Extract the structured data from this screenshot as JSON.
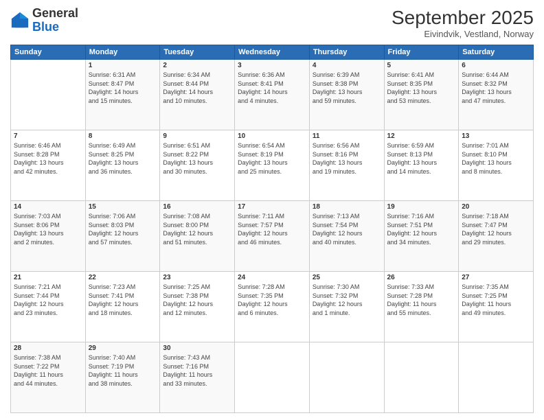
{
  "header": {
    "logo_general": "General",
    "logo_blue": "Blue",
    "month_title": "September 2025",
    "location": "Eivindvik, Vestland, Norway"
  },
  "days_of_week": [
    "Sunday",
    "Monday",
    "Tuesday",
    "Wednesday",
    "Thursday",
    "Friday",
    "Saturday"
  ],
  "weeks": [
    [
      {
        "day": "",
        "info": ""
      },
      {
        "day": "1",
        "info": "Sunrise: 6:31 AM\nSunset: 8:47 PM\nDaylight: 14 hours\nand 15 minutes."
      },
      {
        "day": "2",
        "info": "Sunrise: 6:34 AM\nSunset: 8:44 PM\nDaylight: 14 hours\nand 10 minutes."
      },
      {
        "day": "3",
        "info": "Sunrise: 6:36 AM\nSunset: 8:41 PM\nDaylight: 14 hours\nand 4 minutes."
      },
      {
        "day": "4",
        "info": "Sunrise: 6:39 AM\nSunset: 8:38 PM\nDaylight: 13 hours\nand 59 minutes."
      },
      {
        "day": "5",
        "info": "Sunrise: 6:41 AM\nSunset: 8:35 PM\nDaylight: 13 hours\nand 53 minutes."
      },
      {
        "day": "6",
        "info": "Sunrise: 6:44 AM\nSunset: 8:32 PM\nDaylight: 13 hours\nand 47 minutes."
      }
    ],
    [
      {
        "day": "7",
        "info": "Sunrise: 6:46 AM\nSunset: 8:28 PM\nDaylight: 13 hours\nand 42 minutes."
      },
      {
        "day": "8",
        "info": "Sunrise: 6:49 AM\nSunset: 8:25 PM\nDaylight: 13 hours\nand 36 minutes."
      },
      {
        "day": "9",
        "info": "Sunrise: 6:51 AM\nSunset: 8:22 PM\nDaylight: 13 hours\nand 30 minutes."
      },
      {
        "day": "10",
        "info": "Sunrise: 6:54 AM\nSunset: 8:19 PM\nDaylight: 13 hours\nand 25 minutes."
      },
      {
        "day": "11",
        "info": "Sunrise: 6:56 AM\nSunset: 8:16 PM\nDaylight: 13 hours\nand 19 minutes."
      },
      {
        "day": "12",
        "info": "Sunrise: 6:59 AM\nSunset: 8:13 PM\nDaylight: 13 hours\nand 14 minutes."
      },
      {
        "day": "13",
        "info": "Sunrise: 7:01 AM\nSunset: 8:10 PM\nDaylight: 13 hours\nand 8 minutes."
      }
    ],
    [
      {
        "day": "14",
        "info": "Sunrise: 7:03 AM\nSunset: 8:06 PM\nDaylight: 13 hours\nand 2 minutes."
      },
      {
        "day": "15",
        "info": "Sunrise: 7:06 AM\nSunset: 8:03 PM\nDaylight: 12 hours\nand 57 minutes."
      },
      {
        "day": "16",
        "info": "Sunrise: 7:08 AM\nSunset: 8:00 PM\nDaylight: 12 hours\nand 51 minutes."
      },
      {
        "day": "17",
        "info": "Sunrise: 7:11 AM\nSunset: 7:57 PM\nDaylight: 12 hours\nand 46 minutes."
      },
      {
        "day": "18",
        "info": "Sunrise: 7:13 AM\nSunset: 7:54 PM\nDaylight: 12 hours\nand 40 minutes."
      },
      {
        "day": "19",
        "info": "Sunrise: 7:16 AM\nSunset: 7:51 PM\nDaylight: 12 hours\nand 34 minutes."
      },
      {
        "day": "20",
        "info": "Sunrise: 7:18 AM\nSunset: 7:47 PM\nDaylight: 12 hours\nand 29 minutes."
      }
    ],
    [
      {
        "day": "21",
        "info": "Sunrise: 7:21 AM\nSunset: 7:44 PM\nDaylight: 12 hours\nand 23 minutes."
      },
      {
        "day": "22",
        "info": "Sunrise: 7:23 AM\nSunset: 7:41 PM\nDaylight: 12 hours\nand 18 minutes."
      },
      {
        "day": "23",
        "info": "Sunrise: 7:25 AM\nSunset: 7:38 PM\nDaylight: 12 hours\nand 12 minutes."
      },
      {
        "day": "24",
        "info": "Sunrise: 7:28 AM\nSunset: 7:35 PM\nDaylight: 12 hours\nand 6 minutes."
      },
      {
        "day": "25",
        "info": "Sunrise: 7:30 AM\nSunset: 7:32 PM\nDaylight: 12 hours\nand 1 minute."
      },
      {
        "day": "26",
        "info": "Sunrise: 7:33 AM\nSunset: 7:28 PM\nDaylight: 11 hours\nand 55 minutes."
      },
      {
        "day": "27",
        "info": "Sunrise: 7:35 AM\nSunset: 7:25 PM\nDaylight: 11 hours\nand 49 minutes."
      }
    ],
    [
      {
        "day": "28",
        "info": "Sunrise: 7:38 AM\nSunset: 7:22 PM\nDaylight: 11 hours\nand 44 minutes."
      },
      {
        "day": "29",
        "info": "Sunrise: 7:40 AM\nSunset: 7:19 PM\nDaylight: 11 hours\nand 38 minutes."
      },
      {
        "day": "30",
        "info": "Sunrise: 7:43 AM\nSunset: 7:16 PM\nDaylight: 11 hours\nand 33 minutes."
      },
      {
        "day": "",
        "info": ""
      },
      {
        "day": "",
        "info": ""
      },
      {
        "day": "",
        "info": ""
      },
      {
        "day": "",
        "info": ""
      }
    ]
  ]
}
